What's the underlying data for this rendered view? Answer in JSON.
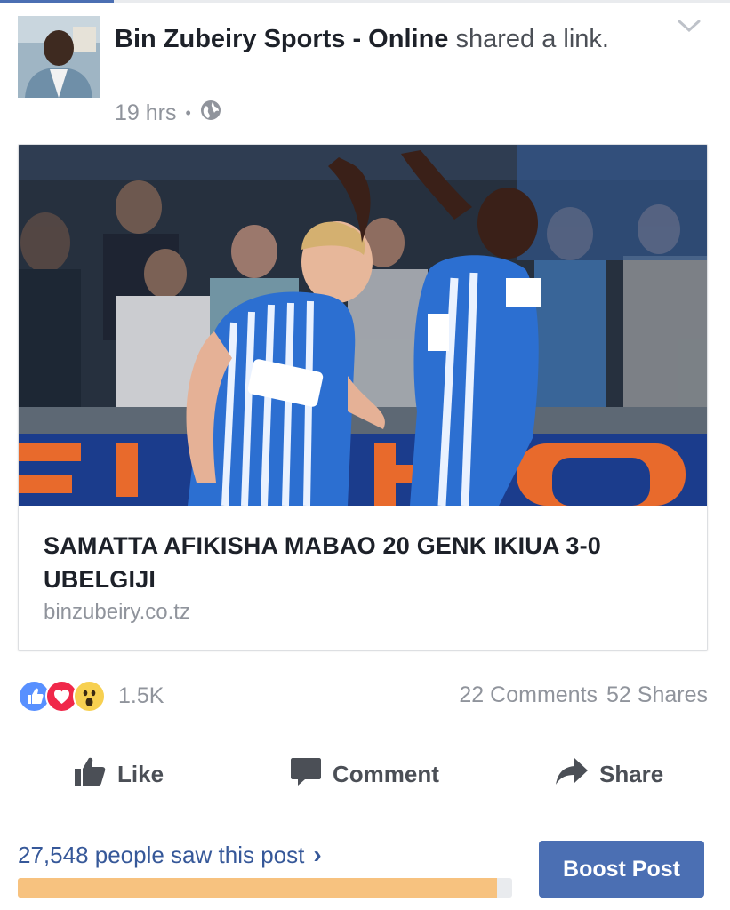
{
  "post": {
    "author": "Bin Zubeiry Sports - Online",
    "action_text": " shared a link.",
    "time": "19 hrs",
    "separator": "•",
    "privacy_icon": "globe-icon"
  },
  "link_card": {
    "headline": "SAMATTA AFIKISHA MABAO 20 GENK IKIUA 3-0 UBELGIJI",
    "domain": "binzubeiry.co.tz",
    "image_icon": "news-photo"
  },
  "reactions": {
    "types": [
      "like-reaction-icon",
      "love-reaction-icon",
      "wow-reaction-icon"
    ],
    "count": "1.5K",
    "comments": "22 Comments",
    "shares": "52 Shares"
  },
  "actions": {
    "like": "Like",
    "comment": "Comment",
    "share": "Share"
  },
  "insights": {
    "reach_text": "27,548 people saw this post",
    "reach_chevron": "›",
    "reach_fill_fraction": 0.97,
    "boost_label": "Boost Post"
  },
  "colors": {
    "link": "#365899",
    "boost": "#4b6fb3",
    "reach_bar": "#f7c27f",
    "muted": "#90949c"
  }
}
